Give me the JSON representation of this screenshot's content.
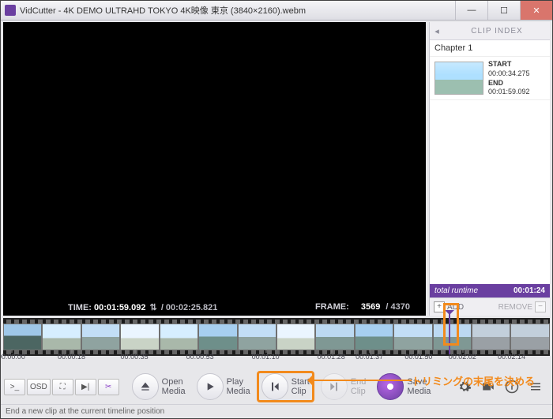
{
  "window": {
    "title": "VidCutter - 4K DEMO ULTRAHD TOKYO 4K映像 東京 (3840×2160).webm"
  },
  "video_status": {
    "time_label": "TIME:",
    "time_current": "00:01:59.092",
    "time_total": "/ 00:02:25.821",
    "frame_label": "FRAME:",
    "frame_current": "3569",
    "frame_total": "/ 4370"
  },
  "side": {
    "index_label": "CLIP INDEX",
    "chapter": "Chapter 1",
    "clip": {
      "start_label": "START",
      "start_time": "00:00:34.275",
      "end_label": "END",
      "end_time": "00:01:59.092"
    },
    "runtime_label": "total runtime",
    "runtime_value": "00:01:24",
    "add_label": "ADD",
    "remove_label": "REMOVE"
  },
  "timeline": {
    "ticks": [
      "00:00:00",
      "00:00:18",
      "00:00:35",
      "00:00:53",
      "00:01:10",
      "00:01:28",
      "00:01:37",
      "00:01:50",
      "00:02:02",
      "00:02:14"
    ],
    "playhead_percent": 81.5
  },
  "toolbar": {
    "console": ">_",
    "osd": "OSD",
    "open1": "Open",
    "open2": "Media",
    "play1": "Play",
    "play2": "Media",
    "start1": "Start",
    "start2": "Clip",
    "end1": "End",
    "end2": "Clip",
    "save1": "Save",
    "save2": "Media"
  },
  "statusbar": {
    "text": "End a new clip at the current timeline position"
  },
  "annotation": {
    "text": "トリミングの末尾を決める"
  }
}
